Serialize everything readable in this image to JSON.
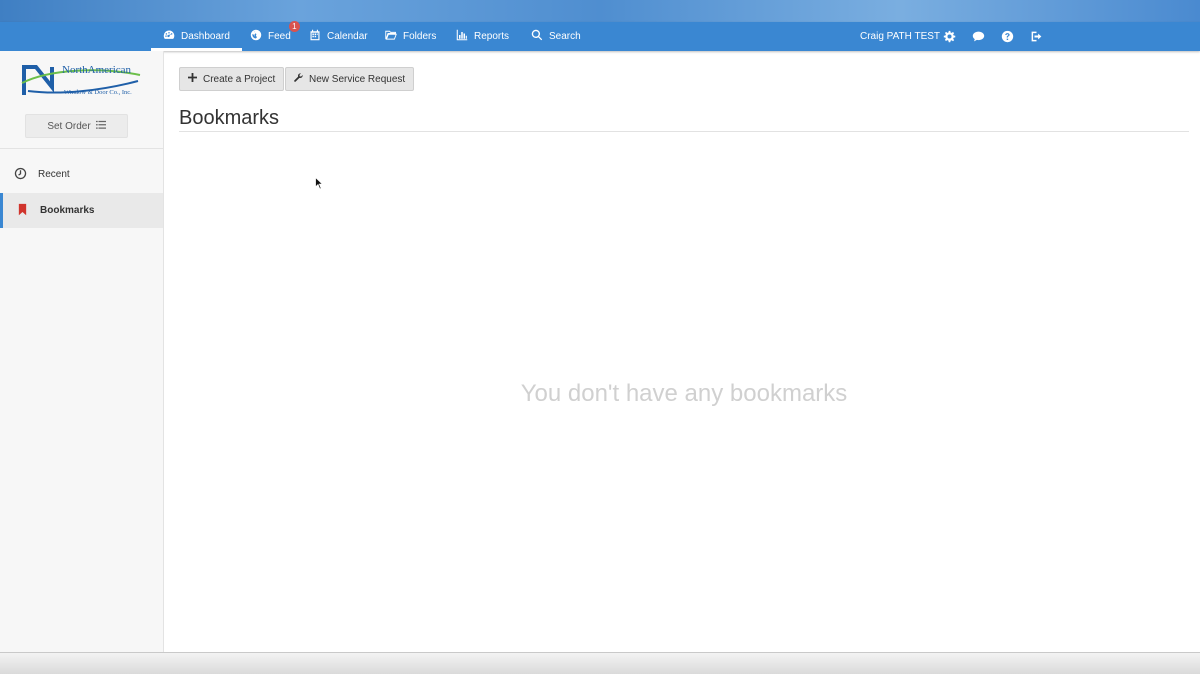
{
  "nav": {
    "items": [
      {
        "label": "Dashboard",
        "icon": "dashboard-icon"
      },
      {
        "label": "Feed",
        "icon": "globe-icon",
        "badge": "1"
      },
      {
        "label": "Calendar",
        "icon": "calendar-icon"
      },
      {
        "label": "Folders",
        "icon": "folder-icon"
      },
      {
        "label": "Reports",
        "icon": "bar-chart-icon"
      },
      {
        "label": "Search",
        "icon": "search-icon"
      }
    ],
    "user_name": "Craig PATH TEST",
    "right_icons": [
      "gear-icon",
      "chat-bubble-icon",
      "help-icon",
      "sign-out-icon"
    ]
  },
  "sidebar": {
    "logo": {
      "name": "NorthAmerican",
      "sub": "Window & Door Co., Inc."
    },
    "set_order_label": "Set Order",
    "items": [
      {
        "label": "Recent",
        "icon": "clock-icon"
      },
      {
        "label": "Bookmarks",
        "icon": "bookmark-icon"
      }
    ]
  },
  "toolbar": {
    "create_project_label": "Create a Project",
    "new_service_request_label": "New Service Request"
  },
  "main": {
    "title": "Bookmarks",
    "empty_message": "You don't have any bookmarks"
  },
  "colors": {
    "accent": "#3a87d2",
    "bookmark_red": "#d0342c"
  }
}
